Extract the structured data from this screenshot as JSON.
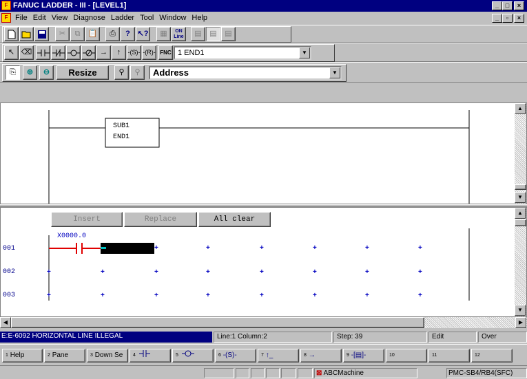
{
  "window": {
    "title": "FANUC LADDER - III - [LEVEL1]"
  },
  "menu": [
    "File",
    "Edit",
    "View",
    "Diagnose",
    "Ladder",
    "Tool",
    "Window",
    "Help"
  ],
  "toolbar3": {
    "resize": "Resize",
    "address_combo": "Address",
    "fnc_label": "FNC",
    "fnc_combo": "1 END1"
  },
  "ladder_top": {
    "box_line1": "SUB1",
    "box_line2": "END1"
  },
  "edit": {
    "insert": "Insert",
    "replace": "Replace",
    "all_clear": "All clear",
    "contact_address": "X0000.0",
    "rows": [
      "001",
      "002",
      "003"
    ]
  },
  "status": {
    "message": "E:E-6092 HORIZONTAL LINE ILLEGAL",
    "position": "Line:1 Column:2",
    "step": "Step: 39",
    "mode": "Edit",
    "overwrite": "Over"
  },
  "fkeys": [
    {
      "num": "1",
      "label": "Help"
    },
    {
      "num": "2",
      "label": "Pane"
    },
    {
      "num": "3",
      "label": "Down Se"
    },
    {
      "num": "4",
      "label": ""
    },
    {
      "num": "5",
      "label": ""
    },
    {
      "num": "6",
      "label": ""
    },
    {
      "num": "7",
      "label": ""
    },
    {
      "num": "8",
      "label": ""
    },
    {
      "num": "9",
      "label": ""
    },
    {
      "num": "10",
      "label": ""
    },
    {
      "num": "11",
      "label": ""
    },
    {
      "num": "12",
      "label": ""
    }
  ],
  "bottom": {
    "machine": "ABCMachine",
    "model": "PMC-SB4/RB4(SFC)"
  },
  "colors": {
    "title_bg": "#000080",
    "status_bg": "#000080",
    "rung_red": "#e00000",
    "dot_blue": "#0000c0",
    "cursor_cyan": "#00c0c0"
  }
}
